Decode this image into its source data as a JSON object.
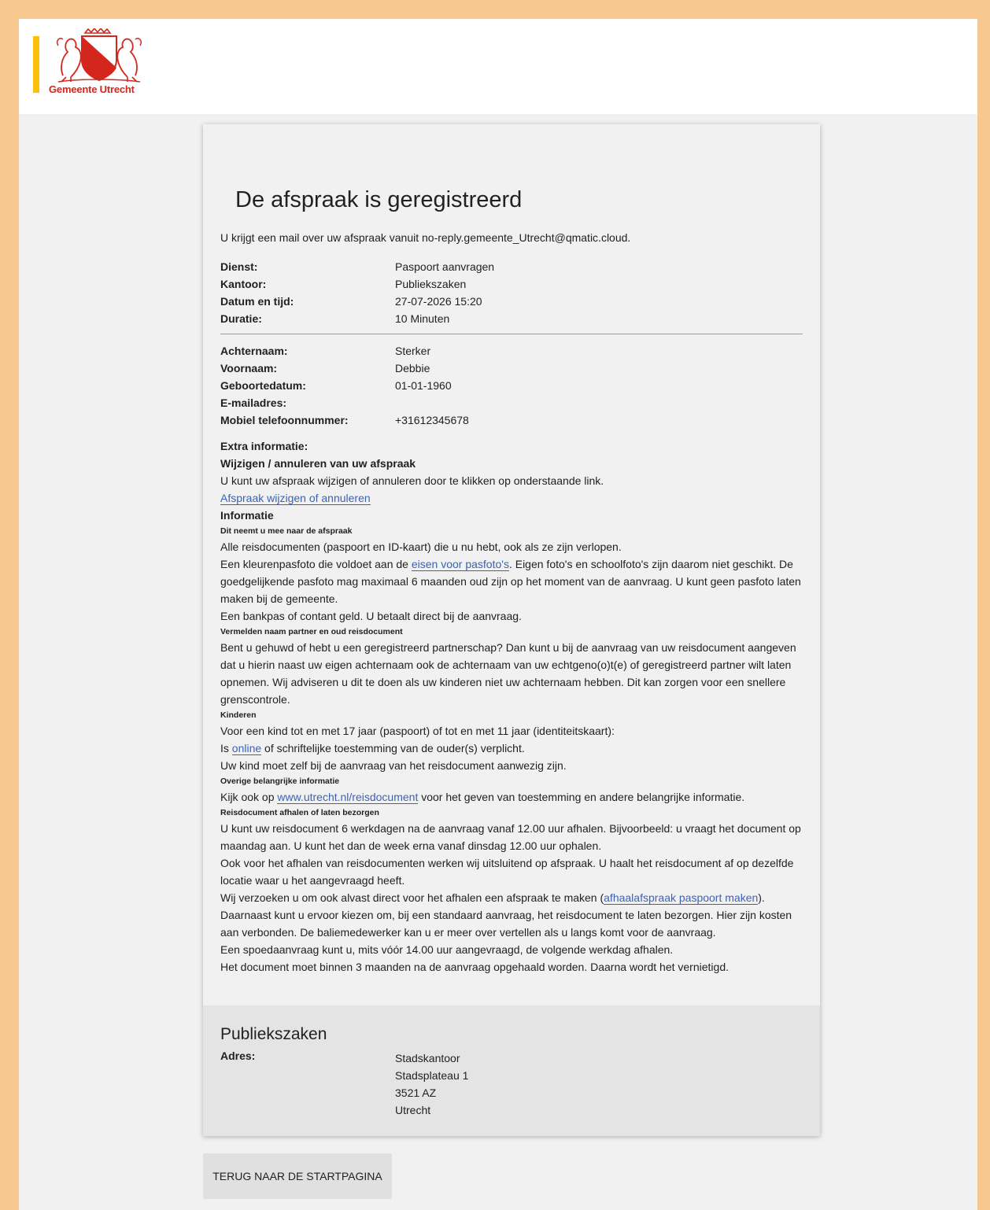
{
  "header": {
    "logo_text": "Gemeente Utrecht"
  },
  "confirmation": {
    "title": "De afspraak is geregistreerd",
    "mail_notice": "U krijgt een mail over uw afspraak vanuit no-reply.gemeente_Utrecht@qmatic.cloud.",
    "appointment": [
      {
        "label": "Dienst:",
        "value": "Paspoort aanvragen"
      },
      {
        "label": "Kantoor:",
        "value": "Publiekszaken"
      },
      {
        "label": "Datum en tijd:",
        "value": "27-07-2026 15:20"
      },
      {
        "label": "Duratie:",
        "value": "10 Minuten"
      }
    ],
    "person": [
      {
        "label": "Achternaam:",
        "value": "Sterker"
      },
      {
        "label": "Voornaam:",
        "value": "Debbie"
      },
      {
        "label": "Geboortedatum:",
        "value": "01-01-1960"
      },
      {
        "label": "E-mailadres:",
        "value": ""
      },
      {
        "label": "Mobiel telefoonnummer:",
        "value": "+31612345678"
      }
    ]
  },
  "extra": {
    "heading": "Extra informatie:",
    "change_heading": "Wijzigen / annuleren van uw afspraak",
    "change_text": "U kunt uw afspraak wijzigen of annuleren door te klikken op onderstaande link.",
    "change_link": "Afspraak wijzigen of annuleren",
    "info_heading": "Informatie",
    "bring_heading": "Dit neemt u mee naar de afspraak",
    "bring_line1": "Alle reisdocumenten (paspoort en ID-kaart) die u nu hebt, ook als ze zijn verlopen.",
    "bring_line2_pre": "Een kleurenpasfoto die voldoet aan de ",
    "bring_line2_link": "eisen voor pasfoto's",
    "bring_line2_post": ". Eigen foto's en schoolfoto's zijn daarom niet geschikt. De goedgelijkende pasfoto mag maximaal 6 maanden oud zijn op het moment van de aanvraag. U kunt geen pasfoto laten maken bij de gemeente.",
    "bring_line3": "Een bankpas of contant geld. U betaalt direct bij de aanvraag.",
    "partner_heading": "Vermelden naam partner en oud reisdocument",
    "partner_text": "Bent u gehuwd of hebt u een geregistreerd partnerschap? Dan kunt u bij de aanvraag van uw reisdocument aangeven dat u hierin naast uw eigen achternaam ook de achternaam van uw echtgeno(o)t(e) of geregistreerd partner wilt laten opnemen. Wij adviseren u dit te doen als uw kinderen niet uw achternaam hebben. Dit kan zorgen voor een snellere grenscontrole.",
    "kids_heading": "Kinderen",
    "kids_line1": "Voor een kind tot en met 17 jaar (paspoort) of tot en met 11 jaar (identiteitskaart):",
    "kids_line2_pre": "Is ",
    "kids_line2_link": "online",
    "kids_line2_post": " of schriftelijke toestemming van de ouder(s) verplicht.",
    "kids_line3": "Uw kind moet zelf bij de aanvraag van het reisdocument aanwezig zijn.",
    "other_heading": "Overige belangrijke informatie",
    "other_pre": "Kijk ook op ",
    "other_link": "www.utrecht.nl/reisdocument",
    "other_post": " voor het geven van toestemming en andere belangrijke informatie.",
    "pickup_heading": "Reisdocument afhalen of laten bezorgen",
    "pickup_line1": "U kunt uw reisdocument 6 werkdagen na de aanvraag vanaf 12.00 uur afhalen. Bijvoorbeeld: u vraagt het document op maandag aan. U kunt het dan de week erna vanaf dinsdag 12.00 uur ophalen.",
    "pickup_line2": "Ook voor het afhalen van reisdocumenten werken wij uitsluitend op afspraak. U haalt het reisdocument af op dezelfde locatie waar u het aangevraagd heeft.",
    "pickup_line3_pre": "Wij verzoeken u om ook alvast direct voor het afhalen een afspraak te maken (",
    "pickup_line3_link": "afhaalafspraak paspoort maken",
    "pickup_line3_post": ").",
    "pickup_line4": "Daarnaast kunt u ervoor kiezen om, bij een standaard aanvraag, het reisdocument te laten bezorgen. Hier zijn kosten aan verbonden. De baliemedewerker kan u er meer over vertellen als u langs komt voor de aanvraag.",
    "pickup_line5": "Een spoedaanvraag kunt u, mits vóór 14.00 uur aangevraagd, de volgende werkdag afhalen.",
    "pickup_line6": "Het document moet binnen 3 maanden na de aanvraag opgehaald worden. Daarna wordt het vernietigd."
  },
  "office": {
    "title": "Publiekszaken",
    "address_label": "Adres:",
    "address_line1": "Stadskantoor",
    "address_line2": "Stadsplateau 1",
    "address_line3": "3521 AZ",
    "address_line4": "Utrecht"
  },
  "back_button": "TERUG NAAR DE STARTPAGINA",
  "colors": {
    "frame": "#f6c88f",
    "accent": "#ffc107",
    "logo_red": "#d3271e",
    "link": "#3b62b5"
  }
}
